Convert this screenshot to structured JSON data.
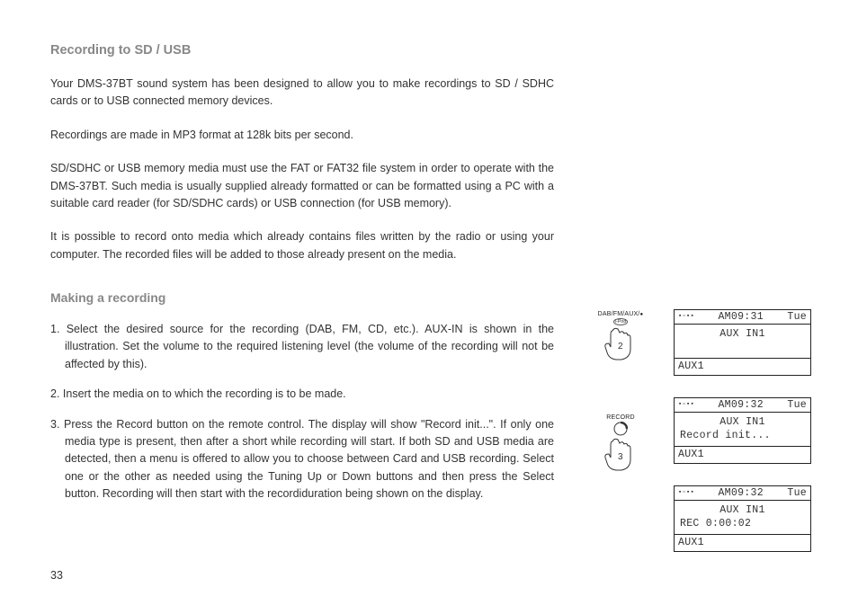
{
  "heading1": "Recording to SD / USB",
  "para1": "Your DMS-37BT sound system has been designed to allow you to make recordings to SD / SDHC cards or to USB connected memory devices.",
  "para2": "Recordings are made in MP3 format at 128k bits per second.",
  "para3": "SD/SDHC or USB memory media must use the FAT or FAT32 file system in order to operate with the DMS-37BT. Such media is usually supplied already formatted or can be formatted using a PC with a suitable card reader (for SD/SDHC cards) or USB connection (for USB memory).",
  "para4": "It is possible to record onto media which already contains files written by the radio or using your computer. The recorded files will be added to those already present on the media.",
  "heading2": "Making a recording",
  "step1": "1. Select the desired source for the recording (DAB, FM, CD, etc.). AUX-IN is shown in the illustration. Set the volume to the required listening level (the volume of the recording will not be affected by this).",
  "step2": "2. Insert the media on to which the recording is to be made.",
  "step3": "3. Press the Record button on the remote control. The display will show \"Record init...\". If only one media type is present, then after a short while recording will start. If both SD and USB media are detected, then a menu is offered to allow you to choose between Card and USB recording. Select one or the other as needed using the Tuning Up or Down buttons and then press the Select button. Recording will then start with the recordiduration being shown on the display.",
  "page_number": "33",
  "button_labels": {
    "fig1": "DAB/FM/AUX/",
    "fig1_sub": "i-Pod",
    "fig2": "RECORD"
  },
  "hand_numbers": {
    "fig1": "2",
    "fig2": "3"
  },
  "lcd": [
    {
      "time": "AM09:31",
      "day": "Tue",
      "line1": "AUX IN1",
      "line2": "",
      "foot": "AUX1"
    },
    {
      "time": "AM09:32",
      "day": "Tue",
      "line1": "AUX IN1",
      "line2": "Record init...",
      "foot": "AUX1"
    },
    {
      "time": "AM09:32",
      "day": "Tue",
      "line1": "AUX IN1",
      "line2": "REC 0:00:02",
      "foot": "AUX1"
    }
  ]
}
